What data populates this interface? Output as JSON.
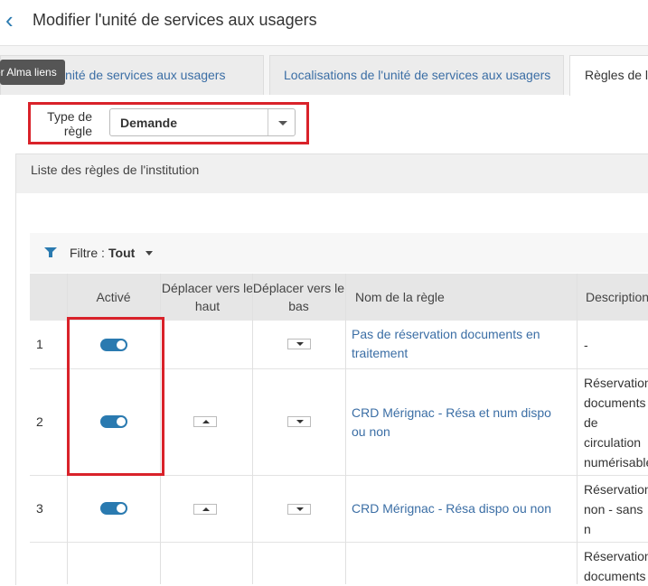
{
  "header": {
    "title": "Modifier l'unité de services aux usagers",
    "back_icon": "chevron-left-icon"
  },
  "tabs": [
    {
      "label": "de l'unité de services aux usagers"
    },
    {
      "label": "Localisations de l'unité de services aux usagers"
    },
    {
      "label": "Règles de l'"
    }
  ],
  "tooltip": "er Alma liens",
  "rule_type": {
    "label": "Type de règle",
    "value": "Demande"
  },
  "section": {
    "title": "Liste des règles de l'institution"
  },
  "filter": {
    "label": "Filtre :",
    "value": "Tout"
  },
  "table": {
    "columns": [
      "Activé",
      "Déplacer vers le haut",
      "Déplacer vers le bas",
      "Nom de la règle",
      "Description"
    ],
    "rows": [
      {
        "num": "1",
        "name": "Pas de réservation documents en traitement",
        "description": "-"
      },
      {
        "num": "2",
        "name": "CRD Mérignac - Résa et num dispo ou non",
        "description": "Réservation documents de circulation numérisable bibliothèque"
      },
      {
        "num": "3",
        "name": "CRD Mérignac - Résa dispo ou non",
        "description": "Réservation non - sans n bibliothèque"
      },
      {
        "num": "",
        "name": "",
        "description": "Réservation documents"
      }
    ]
  },
  "colors": {
    "accent": "#2a7ab0",
    "highlight": "#d9222a"
  }
}
